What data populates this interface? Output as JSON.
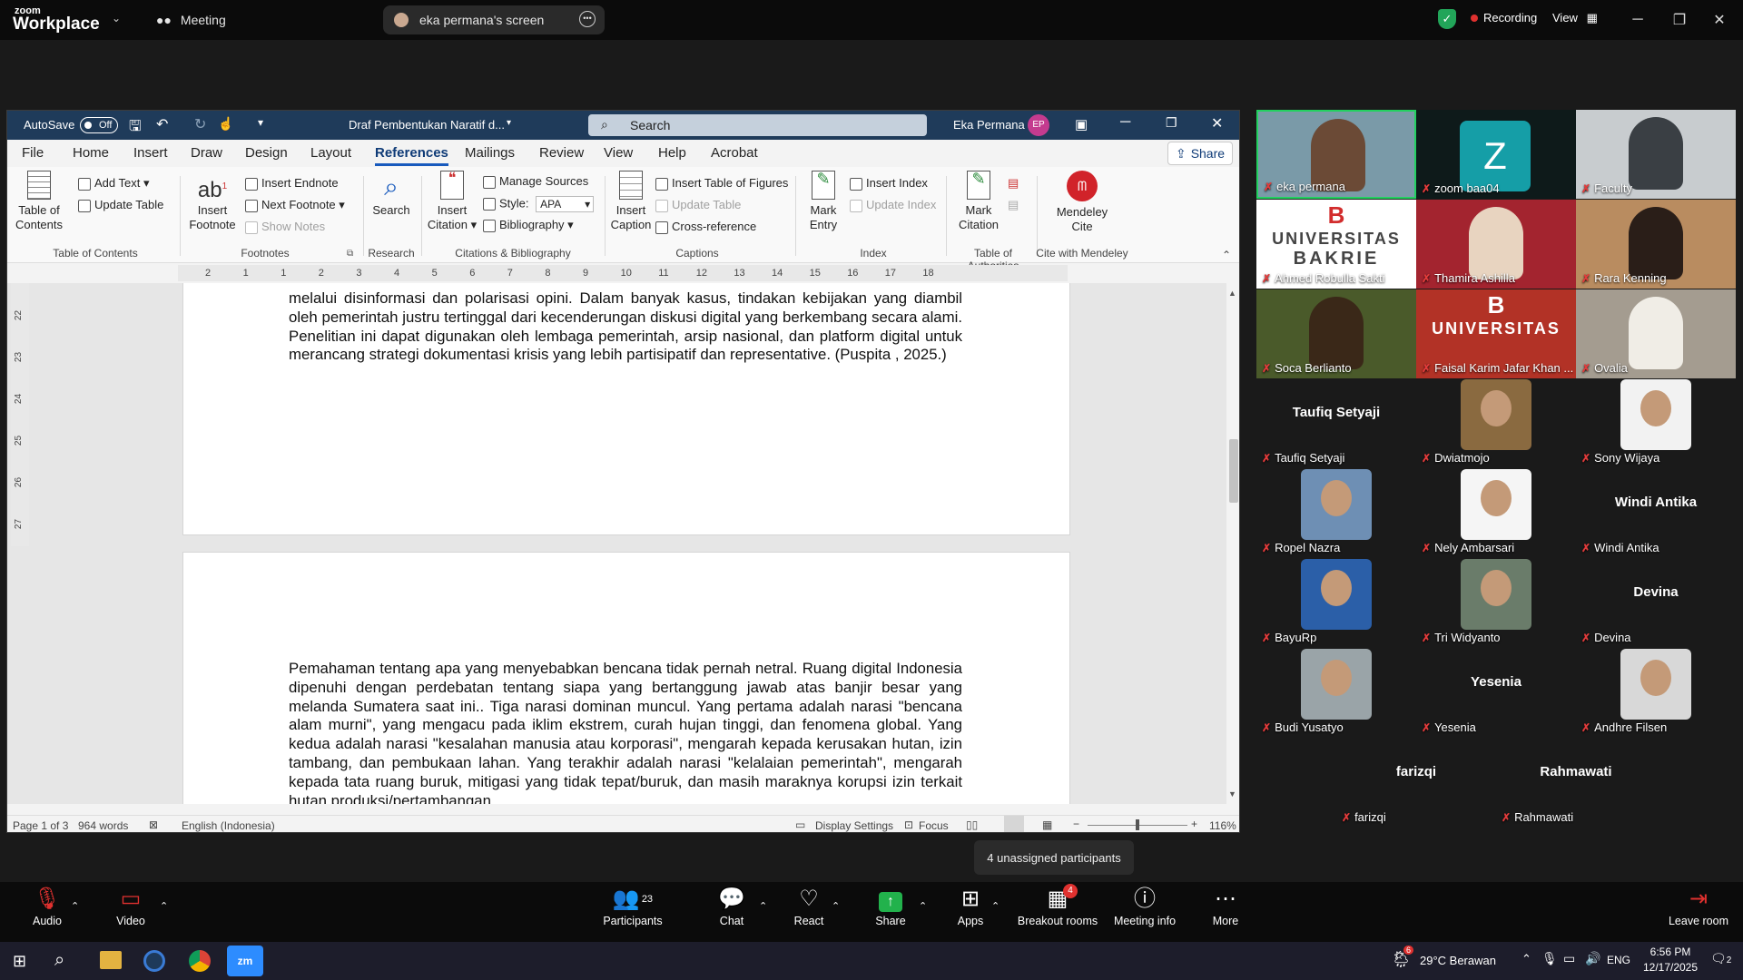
{
  "zoom": {
    "brand_top": "zoom",
    "brand": "Workplace",
    "tabs": [
      "Meeting",
      "eka permana's screen"
    ],
    "security_color": "#22a559",
    "recording": "Recording",
    "view": "View"
  },
  "word": {
    "autosave": "AutoSave",
    "autosave_state": "Off",
    "doc_title": "Draf Pembentukan Naratif d...",
    "search_placeholder": "Search",
    "user": "Eka Permana",
    "user_initials": "EP",
    "tabs": [
      "File",
      "Home",
      "Insert",
      "Draw",
      "Design",
      "Layout",
      "References",
      "Mailings",
      "Review",
      "View",
      "Help",
      "Acrobat"
    ],
    "share": "Share",
    "ribbon": {
      "toc_label": "Table of Contents",
      "add_text": "Add Text",
      "update_table": "Update Table",
      "group_toc": "Table of Contents",
      "insert_footnote": "Insert Footnote",
      "insert_endnote": "Insert Endnote",
      "next_footnote": "Next Footnote",
      "show_notes": "Show Notes",
      "group_footnotes": "Footnotes",
      "search": "Search",
      "group_research": "Research",
      "insert_citation": "Insert Citation",
      "manage_sources": "Manage Sources",
      "style_label": "Style:",
      "style_value": "APA",
      "bibliography": "Bibliography",
      "group_citations": "Citations & Bibliography",
      "insert_caption": "Insert Caption",
      "insert_tof": "Insert Table of Figures",
      "update_table2": "Update Table",
      "cross_reference": "Cross-reference",
      "group_captions": "Captions",
      "mark_entry": "Mark Entry",
      "insert_index": "Insert Index",
      "update_index": "Update Index",
      "group_index": "Index",
      "mark_citation": "Mark Citation",
      "group_toa": "Table of Authorities",
      "mendeley": "Mendeley Cite",
      "group_mendeley": "Cite with Mendeley"
    },
    "ruler_numbers": [
      "2",
      "1",
      "1",
      "2",
      "3",
      "4",
      "5",
      "6",
      "7",
      "8",
      "9",
      "10",
      "11",
      "12",
      "13",
      "14",
      "15",
      "16",
      "17",
      "18"
    ],
    "vruler_numbers": [
      "22",
      "23",
      "24",
      "25",
      "26",
      "27"
    ],
    "para1": "melalui disinformasi dan polarisasi opini. Dalam banyak kasus, tindakan kebijakan yang diambil oleh pemerintah justru tertinggal dari kecenderungan diskusi digital yang berkembang secara alami. Penelitian ini dapat digunakan oleh lembaga pemerintah, arsip nasional, dan platform digital untuk merancang strategi dokumentasi krisis yang lebih partisipatif dan representative. (Puspita , 2025.)",
    "para2": "Pemahaman tentang apa yang menyebabkan bencana tidak pernah netral. Ruang digital Indonesia dipenuhi dengan perdebatan tentang siapa yang bertanggung jawab atas banjir besar yang melanda Sumatera saat ini.. Tiga narasi dominan muncul. Yang pertama adalah narasi \"bencana alam murni\", yang mengacu pada iklim ekstrem, curah hujan tinggi, dan fenomena global. Yang kedua adalah narasi \"kesalahan manusia atau korporasi\", mengarah kepada kerusakan hutan, izin tambang, dan pembukaan lahan. Yang terakhir adalah narasi \"kelalaian pemerintah\", mengarah kepada tata ruang buruk, mitigasi yang tidak tepat/buruk, dan masih maraknya korupsi izin terkait hutan produksi/pertambangan.",
    "status": {
      "page": "Page 1 of 3",
      "words": "964 words",
      "language": "English (Indonesia)",
      "display": "Display Settings",
      "focus": "Focus",
      "zoom": "116%"
    }
  },
  "participants": [
    {
      "name": "eka permana",
      "kind": "video",
      "bg": "#7a9aa8",
      "face": "#6b4a36"
    },
    {
      "name": "zoom baa04",
      "kind": "letter",
      "letter": "Z",
      "bg": "#0e1a1a",
      "face": "#159ea7"
    },
    {
      "name": "Faculty",
      "kind": "video",
      "bg": "#c8cccf",
      "face": "#3a3f44"
    },
    {
      "name": "Ahmed Robulla Sakti",
      "kind": "logo",
      "logo1": "B",
      "logo2": "UNIVERSITAS",
      "logo3": "BAKRIE",
      "bg": "#ffffff",
      "face": "#d22d2d"
    },
    {
      "name": "Thamira Ashilla",
      "kind": "video",
      "bg": "#a3242f",
      "face": "#e8d4c0"
    },
    {
      "name": "Rara Kenning",
      "kind": "video",
      "bg": "#b98c60",
      "face": "#2a1e18"
    },
    {
      "name": "Soca Berlianto",
      "kind": "video",
      "bg": "#4a5a2a",
      "face": "#3a2818"
    },
    {
      "name": "Faisal Karim Jafar Khan ...",
      "kind": "logo",
      "logo1": "B",
      "logo2": "UNIVERSITAS",
      "logo3": "",
      "bg": "#b23226",
      "face": "#b23226"
    },
    {
      "name": "Ovalia",
      "kind": "video",
      "bg": "#a49c90",
      "face": "#f0ede6"
    },
    {
      "name": "Taufiq Setyaji",
      "kind": "name"
    },
    {
      "name": "Dwiatmojo",
      "kind": "photo",
      "bg": "#8a6a40"
    },
    {
      "name": "Sony Wijaya",
      "kind": "photo",
      "bg": "#f2f2f2"
    },
    {
      "name": "Ropel Nazra",
      "kind": "photo",
      "bg": "#6e8fb4"
    },
    {
      "name": "Nely Ambarsari",
      "kind": "photo",
      "bg": "#f5f5f5"
    },
    {
      "name": "Windi Antika",
      "kind": "name"
    },
    {
      "name": "BayuRp",
      "kind": "photo",
      "bg": "#2b5fa8"
    },
    {
      "name": "Tri Widyanto",
      "kind": "photo",
      "bg": "#6a7c6a"
    },
    {
      "name": "Devina",
      "kind": "name"
    },
    {
      "name": "Budi Yusatyo",
      "kind": "photo",
      "bg": "#9aa4a8"
    },
    {
      "name": "Yesenia",
      "kind": "name"
    },
    {
      "name": "Andhre Filsen",
      "kind": "photo",
      "bg": "#d8d8d8"
    },
    {
      "name": "farizqi",
      "kind": "name"
    },
    {
      "name": "Rahmawati",
      "kind": "name"
    }
  ],
  "tooltip": "4 unassigned participants",
  "bottom_bar": {
    "audio": "Audio",
    "video": "Video",
    "participants": "Participants",
    "participants_count": "23",
    "chat": "Chat",
    "react": "React",
    "share": "Share",
    "apps": "Apps",
    "breakout": "Breakout rooms",
    "breakout_badge": "4",
    "meeting_info": "Meeting info",
    "more": "More",
    "leave": "Leave room"
  },
  "taskbar": {
    "weather_badge": "6",
    "weather": "29°C  Berawan",
    "lang": "ENG",
    "time": "6:56 PM",
    "date": "12/17/2025",
    "notif": "2"
  }
}
